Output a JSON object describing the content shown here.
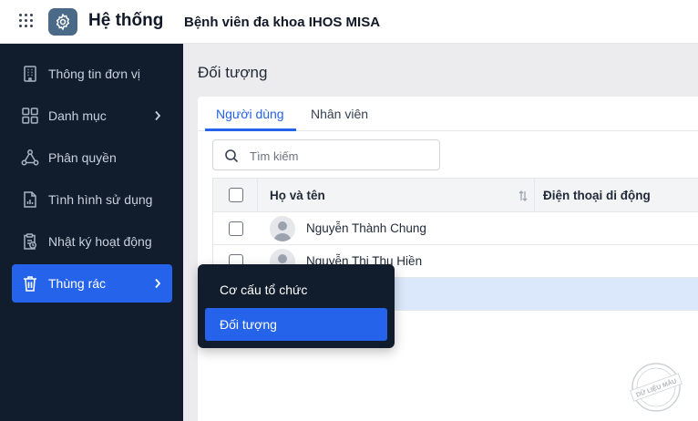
{
  "header": {
    "app_title": "Hệ thống",
    "org_name": "Bệnh viên đa khoa IHOS MISA",
    "grid_icon": "apps-grid-icon",
    "app_icon": "gear-icon"
  },
  "sidebar": {
    "items": [
      {
        "label": "Thông tin đơn vị",
        "icon": "building-icon"
      },
      {
        "label": "Danh mục",
        "icon": "grid-four-icon",
        "has_submenu": true
      },
      {
        "label": "Phân quyền",
        "icon": "share-nodes-icon"
      },
      {
        "label": "Tình hình sử dụng",
        "icon": "document-chart-icon"
      },
      {
        "label": "Nhật ký hoạt động",
        "icon": "clipboard-clock-icon"
      },
      {
        "label": "Thùng rác",
        "icon": "trash-icon",
        "has_submenu": true,
        "active": true
      }
    ]
  },
  "main": {
    "page_title": "Đối tượng",
    "tabs": [
      {
        "label": "Người dùng",
        "active": true
      },
      {
        "label": "Nhân viên",
        "active": false
      }
    ],
    "search": {
      "placeholder": "Tìm kiếm",
      "value": ""
    },
    "table": {
      "columns": [
        "Họ và tên",
        "Điện thoại di động"
      ],
      "rows": [
        {
          "name": "Nguyễn Thành Chung",
          "phone": ""
        },
        {
          "name": "Nguyễn Thị Thu Hiền",
          "phone": ""
        },
        {
          "name": "",
          "phone": ""
        }
      ]
    }
  },
  "submenu": {
    "items": [
      {
        "label": "Cơ cấu tổ chức",
        "active": false
      },
      {
        "label": "Đối tượng",
        "active": true
      }
    ]
  },
  "watermark": {
    "text": "DỮ LIỆU MẪU"
  },
  "colors": {
    "accent": "#2563eb",
    "sidebar_bg": "#111c2d",
    "selected_row": "#dbe8fb"
  }
}
